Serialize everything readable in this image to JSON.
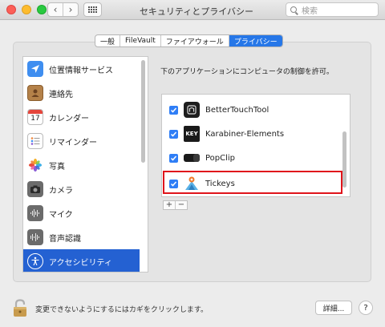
{
  "window": {
    "title": "セキュリティとプライバシー",
    "search_placeholder": "検索",
    "back_symbol": "‹",
    "forward_symbol": "›"
  },
  "tabs": [
    {
      "label": "一般",
      "active": false
    },
    {
      "label": "FileVault",
      "active": false
    },
    {
      "label": "ファイアウォール",
      "active": false
    },
    {
      "label": "プライバシー",
      "active": true
    }
  ],
  "sidebar": {
    "items": [
      {
        "label": "位置情報サービス",
        "icon": "location-icon",
        "color": "#3f8ef0"
      },
      {
        "label": "連絡先",
        "icon": "contacts-icon",
        "color": "#b48149"
      },
      {
        "label": "カレンダー",
        "icon": "calendar-icon",
        "color": "#ffffff"
      },
      {
        "label": "リマインダー",
        "icon": "reminders-icon",
        "color": "#ffffff"
      },
      {
        "label": "写真",
        "icon": "photos-icon",
        "color": "#ffffff"
      },
      {
        "label": "カメラ",
        "icon": "camera-icon",
        "color": "#6b6b6b"
      },
      {
        "label": "マイク",
        "icon": "microphone-icon",
        "color": "#6b6b6b"
      },
      {
        "label": "音声認識",
        "icon": "speech-recognition-icon",
        "color": "#6b6b6b"
      },
      {
        "label": "アクセシビリティ",
        "icon": "accessibility-icon",
        "color": "#2461d2",
        "selected": true
      }
    ],
    "calendar_day": "17"
  },
  "main": {
    "description": "下のアプリケーションにコンピュータの制御を許可。",
    "apps": [
      {
        "name": "BetterTouchTool",
        "checked": true,
        "icon": "bettertouchtool-icon"
      },
      {
        "name": "Karabiner-Elements",
        "checked": true,
        "icon": "karabiner-icon",
        "icon_text": "KEY"
      },
      {
        "name": "PopClip",
        "checked": true,
        "icon": "popclip-icon"
      },
      {
        "name": "Tickeys",
        "checked": true,
        "icon": "tickeys-icon",
        "highlighted": true
      }
    ],
    "add_label": "+",
    "remove_label": "−"
  },
  "footer": {
    "lock_text": "変更できないようにするにはカギをクリックします。",
    "advanced_label": "詳細...",
    "help_label": "?"
  },
  "colors": {
    "accent": "#2677e8",
    "selection": "#2461d2",
    "highlight_box": "#e0141b"
  }
}
